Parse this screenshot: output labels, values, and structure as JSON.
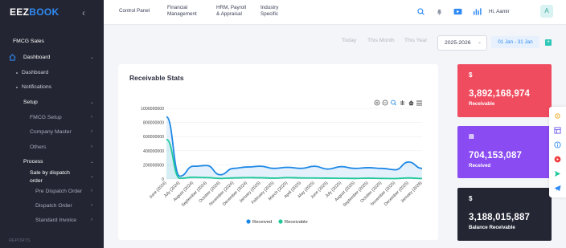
{
  "app": {
    "logo_part1": "EEZ",
    "logo_part2": "BOOK"
  },
  "sidebar": {
    "company": "FMCG Sales",
    "dashboard": "Dashboard",
    "dashboard_sub": "Dashboard",
    "notifications": "Notifications",
    "setup": "Setup",
    "fmcg_setup": "FMCG Setup",
    "company_master": "Company Master",
    "others": "Others",
    "process": "Process",
    "sale_by_dispatch": "Sale by dispatch",
    "sale_by_dispatch_2": "order",
    "pre_dispatch": "Pre Dispatch Order",
    "dispatch_order": "Dispatch Order",
    "standard_invoice": "Standard Invoice",
    "reports": "REPORTS"
  },
  "topnav": {
    "control_panel": "Control Panel",
    "financial_1": "Financial",
    "financial_2": "Management",
    "hrm_1": "HRM, Payroll",
    "hrm_2": "& Appraisal",
    "industry_1": "Industry",
    "industry_2": "Specific",
    "greeting": "Hi, Aamir",
    "avatar_letter": "A"
  },
  "filters": {
    "today": "Today",
    "this_month": "This Month",
    "this_year": "This Year",
    "year_value": "2025-2026",
    "date_range": "01 Jan - 31 Jan",
    "add": "+"
  },
  "card": {
    "title": "Receivable Stats"
  },
  "stats": [
    {
      "symbol": "$",
      "value": "3,892,168,974",
      "label": "Receivable",
      "color": "#f04c5f"
    },
    {
      "symbol": "▤",
      "value": "704,153,087",
      "label": "Received",
      "color": "#8a4bf2"
    },
    {
      "symbol": "$",
      "value": "3,188,015,887",
      "label": "Balance Receivable",
      "color": "#242634"
    }
  ],
  "chart_data": {
    "type": "area",
    "x": [
      "June (2024)",
      "July (2024)",
      "August (2024)",
      "September (2024)",
      "October (2024)",
      "November (2024)",
      "December (2024)",
      "January (2025)",
      "February (2025)",
      "March (2025)",
      "April (2025)",
      "May (2025)",
      "June (2025)",
      "July (2025)",
      "August (2025)",
      "September (2025)",
      "October (2025)",
      "November (2025)",
      "December (2025)",
      "January (2026)"
    ],
    "yticks": [
      "1000000000",
      "800000000",
      "600000000",
      "400000000",
      "200000000",
      "0"
    ],
    "ylim": [
      0,
      1000000000
    ],
    "legend_position": "bottom",
    "series": [
      {
        "name": "Received",
        "color": "#1e88e5",
        "values": [
          880000000,
          40000000,
          180000000,
          190000000,
          60000000,
          150000000,
          170000000,
          180000000,
          150000000,
          165000000,
          150000000,
          180000000,
          140000000,
          175000000,
          150000000,
          160000000,
          150000000,
          130000000,
          240000000,
          150000000
        ]
      },
      {
        "name": "Receivable",
        "color": "#22c89a",
        "values": [
          560000000,
          10000000,
          25000000,
          20000000,
          8000000,
          15000000,
          20000000,
          18000000,
          12000000,
          20000000,
          15000000,
          14000000,
          12000000,
          10000000,
          8000000,
          12000000,
          8000000,
          6000000,
          15000000,
          6000000
        ]
      }
    ]
  },
  "icons": {
    "toolbar": [
      "zoom-in-icon",
      "zoom-out-icon",
      "zoom-select-icon",
      "pan-icon",
      "home-icon",
      "menu-icon"
    ],
    "floating": [
      "settings-icon",
      "layout-icon",
      "info-icon",
      "youtube-icon",
      "send-icon",
      "telegram-icon"
    ]
  }
}
